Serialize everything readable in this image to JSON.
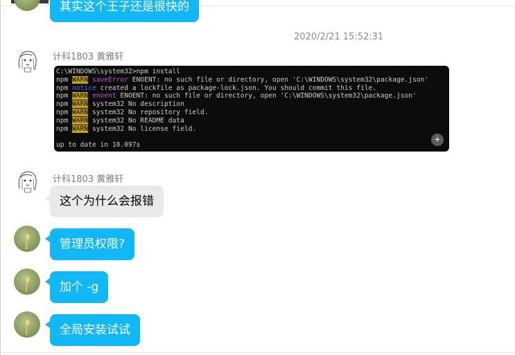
{
  "messages": {
    "top_partial": {
      "text": "其实这个王子还是很快的"
    },
    "timestamp": "2020/2/21 15:52:31",
    "terminal_msg": {
      "sender": "计科1803   黄雅轩",
      "lines": [
        {
          "prefix": "C:\\WINDOWS\\system32>npm install",
          "tag": "",
          "rest": ""
        },
        {
          "prefix": "npm ",
          "tag": "WARN",
          "tag2": "saveError",
          "rest": " ENOENT: no such file or directory, open 'C:\\WINDOWS\\system32\\package.json'"
        },
        {
          "prefix": "npm ",
          "tag": "",
          "tag2": "notice",
          "rest": " created a lockfile as package-lock.json. You should commit this file."
        },
        {
          "prefix": "npm ",
          "tag": "WARN",
          "tag2": "enoent",
          "rest": " ENOENT: no such file or directory, open 'C:\\WINDOWS\\system32\\package.json'"
        },
        {
          "prefix": "npm ",
          "tag": "WARN",
          "tag2": "",
          "rest": " system32 No description"
        },
        {
          "prefix": "npm ",
          "tag": "WARN",
          "tag2": "",
          "rest": " system32 No repository field."
        },
        {
          "prefix": "npm ",
          "tag": "WARN",
          "tag2": "",
          "rest": " system32 No README data"
        },
        {
          "prefix": "npm ",
          "tag": "WARN",
          "tag2": "",
          "rest": " system32 No license field."
        },
        {
          "prefix": "",
          "tag": "",
          "tag2": "",
          "rest": ""
        },
        {
          "prefix": "up to date in 10.097s",
          "tag": "",
          "tag2": "",
          "rest": ""
        }
      ]
    },
    "question_msg": {
      "sender": "计科1803   黄雅轩",
      "text": "这个为什么会报错"
    },
    "reply1": {
      "text": "管理员权限?"
    },
    "reply2": {
      "text": "加个 -g"
    },
    "reply3": {
      "text": "全局安装试试"
    }
  },
  "colors": {
    "bubble_blue": "#12b7f5",
    "bubble_gray": "#e9e9e9",
    "terminal_bg": "#0c0c0c",
    "warn_bg": "#c9a600"
  },
  "icons": {
    "zoom": "zoom-in-icon"
  }
}
